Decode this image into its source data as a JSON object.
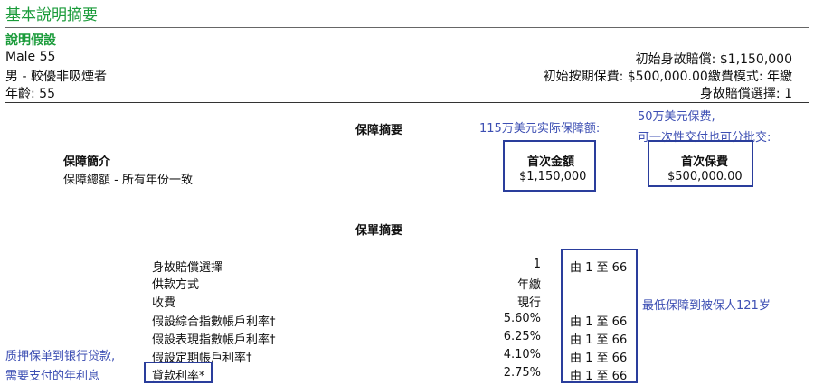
{
  "header": {
    "title": "基本說明摘要",
    "section": "說明假設"
  },
  "insured": {
    "name_age": "Male 55",
    "class": "男 - 較優非吸煙者",
    "age": "年齡: 55"
  },
  "policy_info": {
    "initial_death_benefit": "初始身故賠償: $1,150,000",
    "initial_premium_mode": "初始按期保費: $500,000.00繳費模式: 年繳",
    "death_benefit_option": "身故賠償選擇: 1"
  },
  "coverage_summary": {
    "heading": "保障摘要",
    "sub_heading": "保障簡介",
    "row_label": "保障總額 - 所有年份一致",
    "col1_header": "首次金額",
    "col1_value": "$1,150,000",
    "col2_header": "首次保費",
    "col2_value": "$500,000.00"
  },
  "policy_summary": {
    "heading": "保單摘要",
    "rows": [
      {
        "label": "身故賠償選擇",
        "value": "1",
        "range": "由 1 至 66"
      },
      {
        "label": "供款方式",
        "value": "年繳",
        "range": ""
      },
      {
        "label": "收費",
        "value": "現行",
        "range": ""
      },
      {
        "label": "假設綜合指數帳戶利率†",
        "value": "5.60%",
        "range": "由 1 至 66"
      },
      {
        "label": "假設表現指數帳戶利率†",
        "value": "6.25%",
        "range": "由 1 至 66"
      },
      {
        "label": "假設定期帳戶利率†",
        "value": "4.10%",
        "range": "由 1 至 66"
      },
      {
        "label": "貸款利率*",
        "value": "2.75%",
        "range": "由 1 至 66"
      }
    ]
  },
  "annotations": {
    "coverage_note": "115万美元实际保障额:",
    "premium_note_line1": "50万美元保费,",
    "premium_note_line2": "可一次性交付也可分批交:",
    "age_note": "最低保障到被保人121岁",
    "loan_note_line1": "质押保单到银行贷款,",
    "loan_note_line2": "需要支付的年利息"
  },
  "colors": {
    "title_green": "#1a9b3a",
    "annotation_blue": "#3d4fb3",
    "box_border": "#2a3d9c"
  }
}
